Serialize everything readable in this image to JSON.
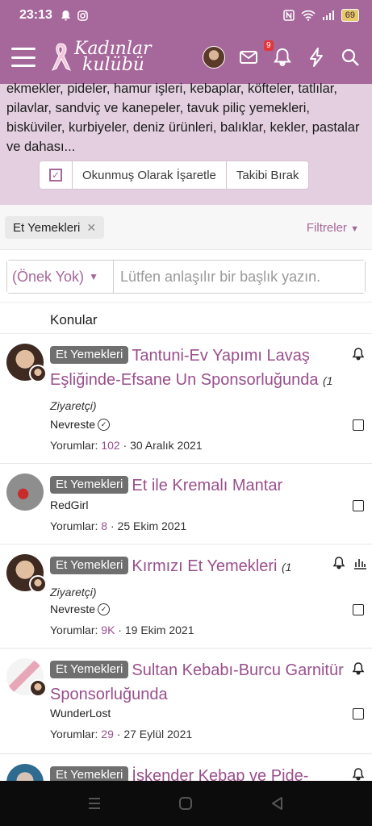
{
  "status_bar": {
    "time": "23:13",
    "battery": "69"
  },
  "header": {
    "logo_line1": "Kadınlar",
    "logo_line2": "kulübü",
    "notification_count": "9"
  },
  "description": "ekmekler, pideler, hamur işleri, kebaplar, köfteler, tatlılar, pilavlar, sandviç ve kanepeler, tavuk piliç yemekleri, bisküviler, kurbiyeler, deniz ürünleri, balıklar, kekler, pastalar ve dahası...",
  "actions": {
    "mark_read": "Okunmuş Olarak İşaretle",
    "unfollow": "Takibi Bırak"
  },
  "filter": {
    "active_tag": "Et Yemekleri",
    "filters_label": "Filtreler"
  },
  "search": {
    "prefix_selected": "(Önek Yok)",
    "placeholder": "Lütfen anlaşılır bir başlık yazın."
  },
  "section_title": "Konular",
  "threads": [
    {
      "prefix": "Et Yemekleri",
      "title": "Tantuni-Ev Yapımı Lavaş Eşliğinde-Efsane Un Sponsorluğunda",
      "visitors": "(1 Ziyaretçi)",
      "author": "Nevreste",
      "replies_label": "Yorumlar:",
      "replies": "102",
      "date": "30 Aralık 2021"
    },
    {
      "prefix": "Et Yemekleri",
      "title": "Et ile Kremalı Mantar",
      "author": "RedGirl",
      "replies_label": "Yorumlar:",
      "replies": "8",
      "date": "25 Ekim 2021"
    },
    {
      "prefix": "Et Yemekleri",
      "title": "Kırmızı Et Yemekleri",
      "visitors": "(1 Ziyaretçi)",
      "author": "Nevreste",
      "replies_label": "Yorumlar:",
      "replies": "9K",
      "date": "19 Ekim 2021"
    },
    {
      "prefix": "Et Yemekleri",
      "title": "Sultan Kebabı-Burcu Garnitür Sponsorluğunda",
      "author": "WunderLost",
      "replies_label": "Yorumlar:",
      "replies": "29",
      "date": "27 Eylül 2021"
    },
    {
      "prefix": "Et Yemekleri",
      "title": "İskender Kebap ve Pide-"
    }
  ],
  "colors": {
    "brand": "#a6679a",
    "link": "#9a4f8c",
    "prefix_pill": "#6f6f6f"
  }
}
